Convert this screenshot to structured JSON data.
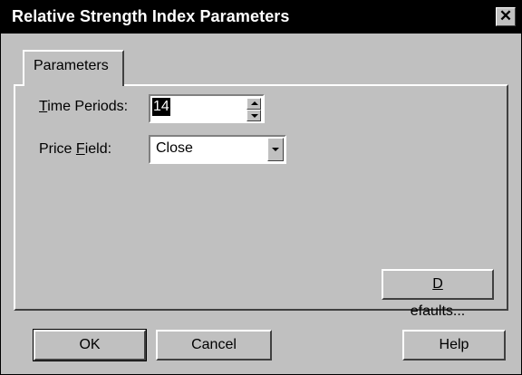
{
  "window": {
    "title": "Relative Strength Index Parameters",
    "close_glyph": "✕"
  },
  "tabs": [
    {
      "label": "Parameters",
      "selected": true
    }
  ],
  "form": {
    "time_periods": {
      "label_prefix": "",
      "label_mnemonic": "T",
      "label_rest": "ime Periods:",
      "value": "14"
    },
    "price_field": {
      "label_prefix": "Price ",
      "label_mnemonic": "F",
      "label_rest": "ield:",
      "value": "Close"
    }
  },
  "buttons": {
    "defaults": {
      "mnemonic": "D",
      "rest": "efaults..."
    },
    "ok": "OK",
    "cancel": "Cancel",
    "help": "Help"
  },
  "icons": {
    "close": "close-icon",
    "spin_up": "arrow-up-icon",
    "spin_down": "arrow-down-icon",
    "dropdown": "chevron-down-icon"
  }
}
